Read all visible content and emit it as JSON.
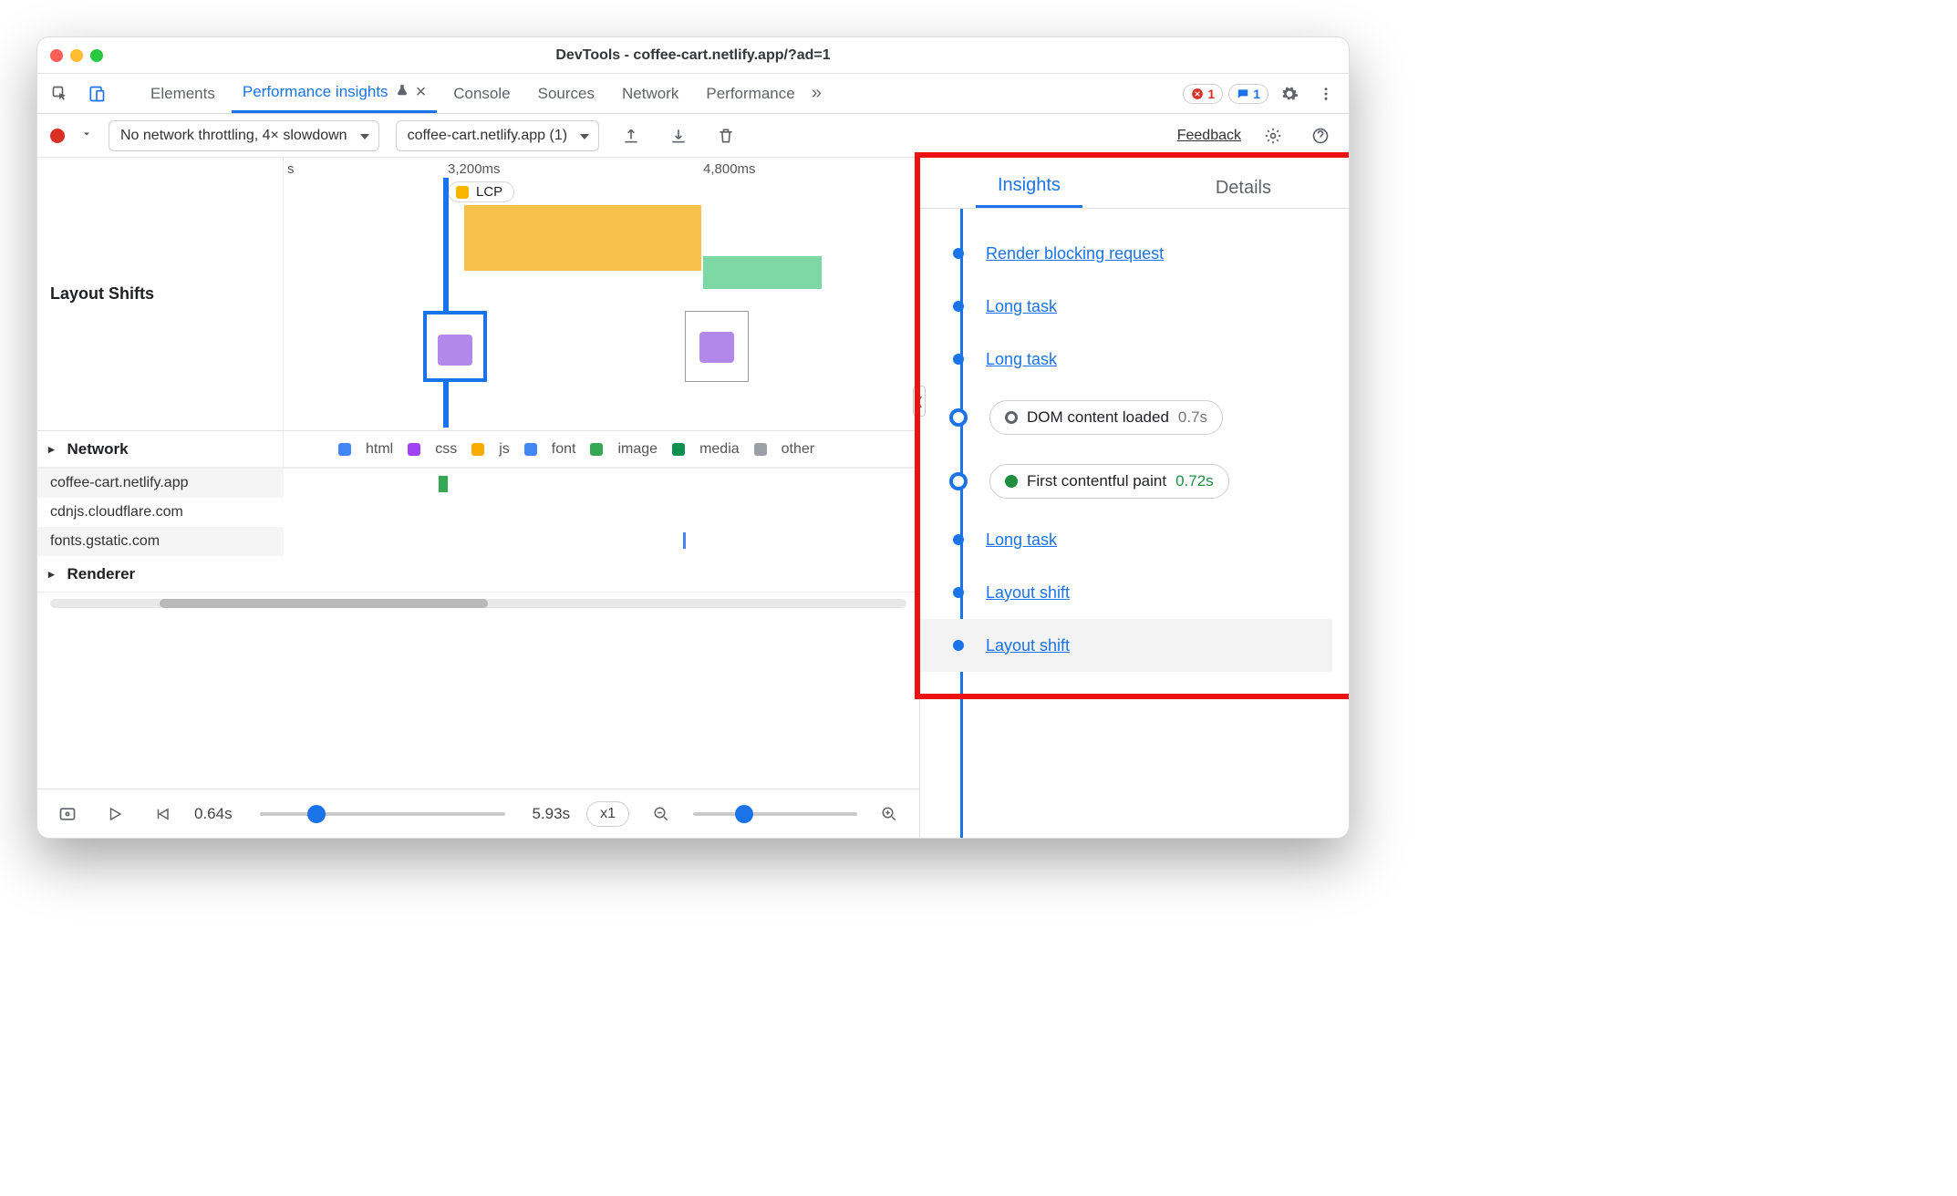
{
  "window": {
    "title": "DevTools - coffee-cart.netlify.app/?ad=1"
  },
  "tabs": {
    "items": [
      "Elements",
      "Performance insights",
      "Console",
      "Sources",
      "Network",
      "Performance"
    ],
    "active": 1,
    "close_glyph": "×",
    "more_glyph": "»",
    "error_count": "1",
    "message_count": "1"
  },
  "subbar": {
    "throttling": "No network throttling, 4× slowdown",
    "page_select": "coffee-cart.netlify.app (1)",
    "feedback": "Feedback"
  },
  "timeline": {
    "section_label": "Layout Shifts",
    "ticks": {
      "t0": "s",
      "t1": "3,200ms",
      "t2": "4,800ms"
    },
    "lcp_label": "LCP"
  },
  "network": {
    "header": "Network",
    "legend": {
      "html": "html",
      "css": "css",
      "js": "js",
      "font": "font",
      "image": "image",
      "media": "media",
      "other": "other"
    },
    "rows": [
      "coffee-cart.netlify.app",
      "cdnjs.cloudflare.com",
      "fonts.gstatic.com"
    ]
  },
  "renderer": {
    "header": "Renderer"
  },
  "player": {
    "start_time": "0.64s",
    "end_time": "5.93s",
    "zoom": "x1"
  },
  "right": {
    "tabs": {
      "insights": "Insights",
      "details": "Details"
    },
    "items": [
      {
        "type": "link",
        "label": "Render blocking request"
      },
      {
        "type": "link",
        "label": "Long task"
      },
      {
        "type": "link",
        "label": "Long task"
      },
      {
        "type": "milestone",
        "dot": "#5f6368",
        "label": "DOM content loaded",
        "value": "0.7s",
        "good": false
      },
      {
        "type": "milestone",
        "dot": "#1e8e3e",
        "label": "First contentful paint",
        "value": "0.72s",
        "good": true
      },
      {
        "type": "link",
        "label": "Long task"
      },
      {
        "type": "link",
        "label": "Layout shift"
      },
      {
        "type": "link",
        "label": "Layout shift"
      }
    ]
  },
  "colors": {
    "html": "#4285f4",
    "css": "#a142f4",
    "js": "#f9ab00",
    "font": "#4285f4",
    "image": "#34a853",
    "media": "#0d904f",
    "other": "#9aa0a6"
  }
}
